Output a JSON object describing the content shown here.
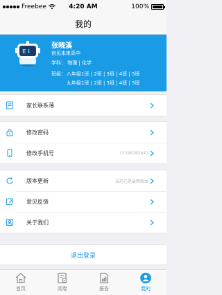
{
  "status_bar": {
    "carrier": "Freebee",
    "time": "4:20 AM",
    "battery": "100%"
  },
  "nav": {
    "title": "我的"
  },
  "profile": {
    "name": "张晓溪",
    "school": "创见未来高中",
    "subjects": "学科： 物理 | 化学",
    "classes_label": "班级：",
    "class_rows": [
      "八年级1班 | 2班 | 3班 | 4班 | 5班",
      "九年级1班 | 2班 | 3班 | 4班 | 5班"
    ]
  },
  "menu": {
    "contacts": "家长联系薄",
    "password": "修改密码",
    "phone": "修改手机号",
    "phone_value": "15396785643",
    "update": "版本更新",
    "update_value": "当前已是最新版本",
    "feedback": "意见反馈",
    "about": "关于我们"
  },
  "logout": {
    "label": "退出登录"
  },
  "tabs": [
    {
      "label": "首页"
    },
    {
      "label": "阅卷"
    },
    {
      "label": "报告"
    },
    {
      "label": "我的"
    }
  ],
  "colors": {
    "accent": "#1a9be6",
    "background": "#efeff4"
  }
}
